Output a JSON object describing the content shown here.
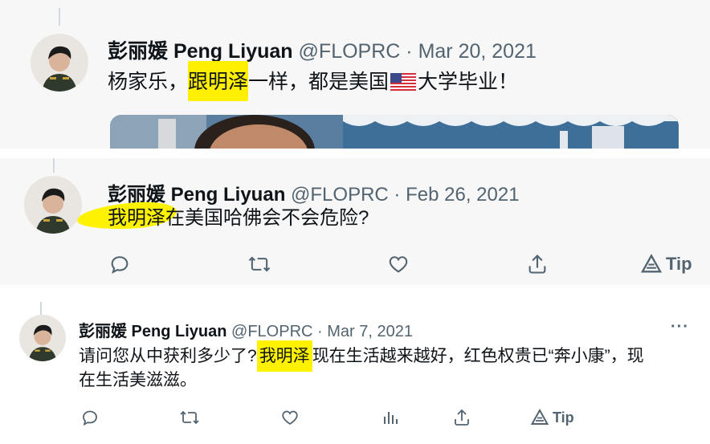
{
  "tweets": [
    {
      "name": "彭丽媛 Peng Liyuan",
      "handle": "@FLOPRC",
      "separator": "·",
      "date": "Mar 20, 2021",
      "text_before": "杨家乐，",
      "text_highlight": "跟明泽",
      "text_after_a": "一样，都是美国",
      "flag_icon": "us-flag-emoji",
      "text_after_b": "大学毕业！"
    },
    {
      "name": "彭丽媛 Peng Liyuan",
      "handle": "@FLOPRC",
      "separator": "·",
      "date": "Feb 26, 2021",
      "text_highlight": "我明泽",
      "text_after": "在美国哈佛会不会危险?",
      "actions": [
        "reply-icon",
        "retweet-icon",
        "like-icon",
        "share-icon",
        "tip-icon"
      ],
      "tip_label": "Tip"
    },
    {
      "name": "彭丽媛 Peng Liyuan",
      "handle": "@FLOPRC",
      "separator": "·",
      "date": "Mar 7, 2021",
      "more": "···",
      "line1_before": "请问您从中获利多少了?",
      "line1_highlight": "我明泽",
      "line1_after": "现在生活越来越好，红色权贵已“奔小康”，现",
      "line2": "在生活美滋滋。",
      "actions": [
        "reply-icon",
        "retweet-icon",
        "like-icon",
        "views-icon",
        "share-icon",
        "tip-icon"
      ],
      "tip_label": "Tip"
    }
  ],
  "colors": {
    "highlight": "#fff200",
    "meta": "#536471",
    "text": "#0f1419"
  }
}
